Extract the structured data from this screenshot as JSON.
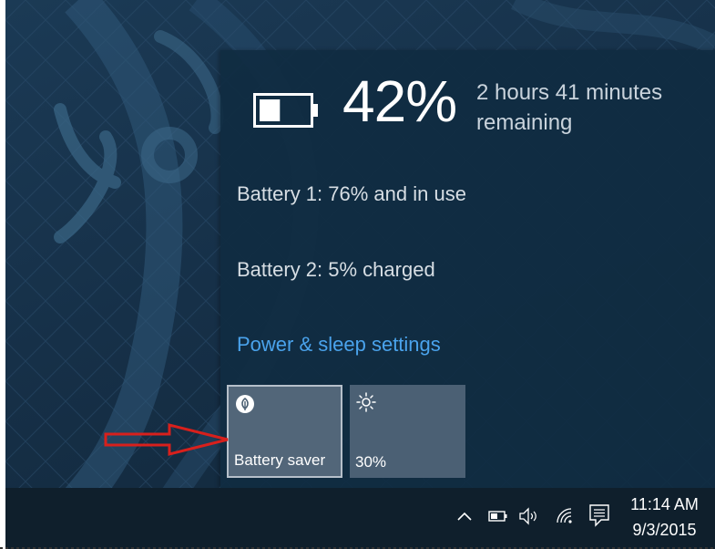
{
  "flyout": {
    "percent": "42%",
    "remaining_line1": "2 hours 41 minutes",
    "remaining_line2": "remaining",
    "battery1": "Battery 1: 76% and in use",
    "battery2": "Battery 2: 5% charged",
    "settings_link": "Power & sleep settings",
    "battery_level": 0.42,
    "tiles": [
      {
        "label": "Battery saver",
        "icon": "battery-saver-leaf-icon"
      },
      {
        "label": "30%",
        "icon": "brightness-sun-icon"
      }
    ]
  },
  "taskbar": {
    "tray_icons": [
      "chevron-up-icon",
      "battery-icon",
      "volume-icon",
      "wifi-icon",
      "action-center-icon"
    ],
    "time": "11:14 AM",
    "date": "9/3/2015"
  },
  "colors": {
    "flyout_bg": "#102c42",
    "link": "#4aa3ec",
    "tile": "#4a5f72",
    "annotation": "#d8201c",
    "taskbar": "#0f1f2c"
  }
}
